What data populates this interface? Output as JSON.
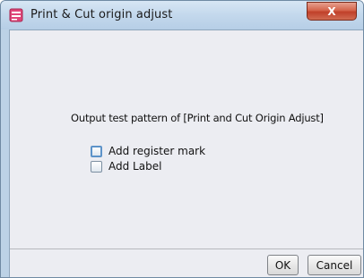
{
  "window": {
    "title": "Print & Cut origin adjust",
    "close_label": "X"
  },
  "dialog": {
    "prompt": "Output test pattern of [Print and Cut Origin Adjust]",
    "options": [
      {
        "label": "Add register mark",
        "checked": false,
        "focused": true
      },
      {
        "label": "Add Label",
        "checked": false,
        "focused": false
      }
    ]
  },
  "buttons": {
    "ok_label": "OK",
    "cancel_label": "Cancel"
  },
  "colors": {
    "title_bar": "#c3d8ec",
    "client_background": "#ecedf2",
    "close_button": "#d5654c",
    "app_icon_accent": "#e0457a"
  }
}
